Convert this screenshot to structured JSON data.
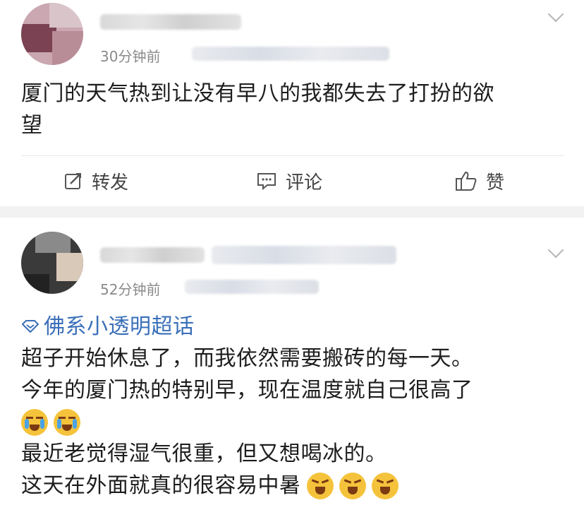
{
  "posts": [
    {
      "time": "30分钟前",
      "text_lines": [
        "厦门的天气热到让没有早八的我都失去了打扮的欲",
        "望"
      ],
      "actions": {
        "repost": "转发",
        "comment": "评论",
        "like": "赞"
      }
    },
    {
      "time": "52分钟前",
      "topic": "佛系小透明超话",
      "text_lines": [
        "超子开始休息了，而我依然需要搬砖的每一天。",
        "今年的厦门热的特别早，现在温度就自己很高了",
        "最近老觉得湿气很重，但又想喝冰的。",
        "这天在外面就真的很容易中暑"
      ]
    }
  ],
  "colors": {
    "topic": "#3a6fb8",
    "card_bg": "#ffffff",
    "page_bg": "#f2f2f2",
    "time": "#8a8a8a"
  },
  "icons": {
    "repost": "edit-share-icon",
    "comment": "comment-bubble-icon",
    "like": "thumbs-up-icon",
    "topic": "diamond-icon",
    "menu": "chevron-down-icon",
    "emoji_cry": "crying-face-emoji",
    "emoji_angry": "angry-face-emoji"
  }
}
